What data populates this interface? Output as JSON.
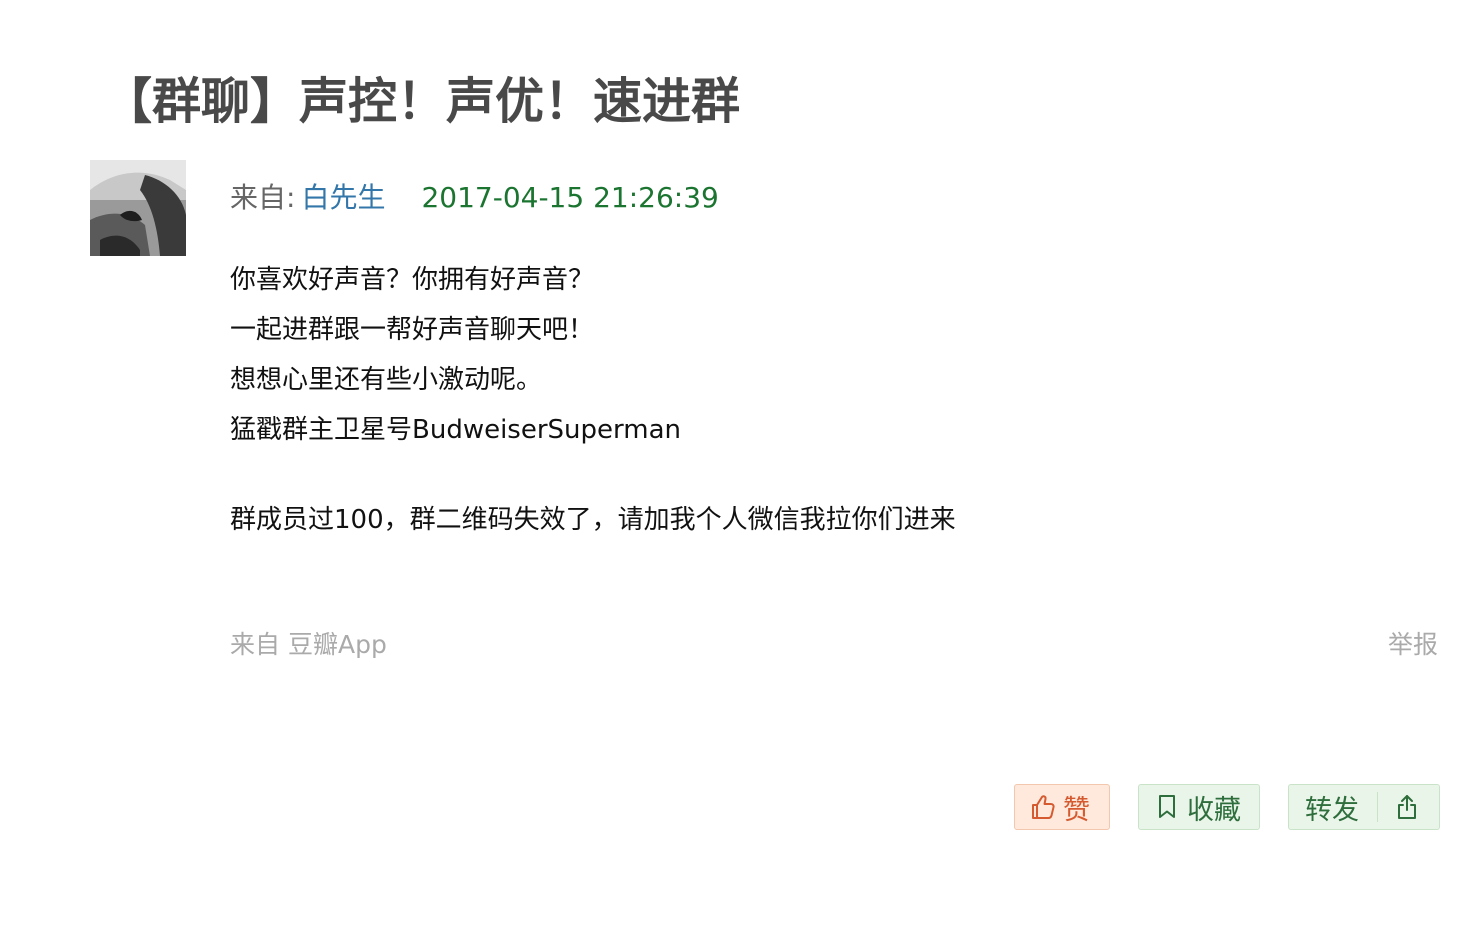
{
  "post": {
    "title": "【群聊】声控！声优！速进群",
    "from_label": "来自:",
    "author": "白先生",
    "timestamp": "2017-04-15 21:26:39",
    "content": [
      "你喜欢好声音？你拥有好声音？",
      "一起进群跟一帮好声音聊天吧！",
      "想想心里还有些小激动呢。",
      "猛戳群主卫星号BudweiserSuperman",
      "群成员过100，群二维码失效了，请加我个人微信我拉你们进来"
    ],
    "source_prefix": "来自",
    "source_app": "豆瓣App",
    "report_label": "举报"
  },
  "actions": {
    "like_label": "赞",
    "collect_label": "收藏",
    "share_label": "转发"
  },
  "colors": {
    "title": "#494949",
    "author_link": "#3377aa",
    "timestamp": "#1b7530",
    "like_bg": "#fee9dc",
    "like_text": "#d55a30",
    "green_button_bg": "#eaf5ea",
    "green_button_text": "#2e6e3c",
    "muted_text": "#aaaaaa"
  },
  "icons": {
    "like": "thumbs-up-icon",
    "collect": "bookmark-icon",
    "share": "share-export-icon"
  }
}
